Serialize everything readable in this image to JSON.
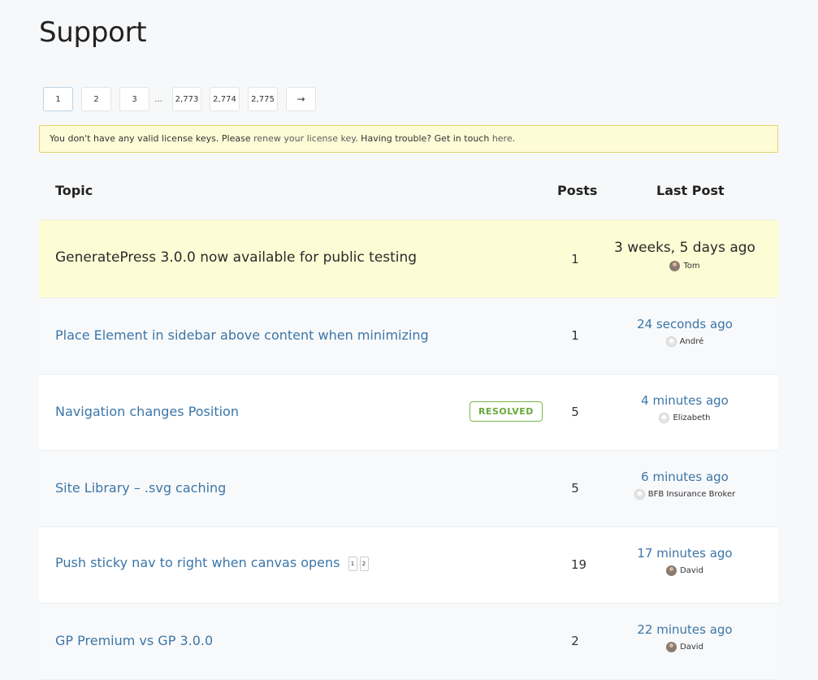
{
  "page": {
    "title": "Support"
  },
  "pagination": {
    "pages": [
      "1",
      "2",
      "3",
      "2,773",
      "2,774",
      "2,775"
    ],
    "dots": "…",
    "next_arrow": "→"
  },
  "notice": {
    "text_before": "You don't have any valid license keys. Please ",
    "renew_link": "renew your license key",
    "text_middle": ". Having trouble? Get in touch ",
    "here_link": "here",
    "text_after": "."
  },
  "table": {
    "headers": {
      "topic": "Topic",
      "posts": "Posts",
      "last_post": "Last Post"
    },
    "rows": [
      {
        "title": "GeneratePress 3.0.0 now available for public testing",
        "posts": "1",
        "last_time": "3 weeks, 5 days ago",
        "author": "Tom",
        "avatar": "photo"
      },
      {
        "title": "Place Element in sidebar above content when minimizing",
        "posts": "1",
        "last_time": "24 seconds ago",
        "author": "André",
        "avatar": "generic"
      },
      {
        "title": "Navigation changes Position",
        "badge": "RESOLVED",
        "posts": "5",
        "last_time": "4 minutes ago",
        "author": "Elizabeth",
        "avatar": "generic"
      },
      {
        "title": "Site Library – .svg caching",
        "posts": "5",
        "last_time": "6 minutes ago",
        "author": "BFB Insurance Broker",
        "avatar": "generic"
      },
      {
        "title": "Push sticky nav to right when canvas opens",
        "subpages": [
          "1",
          "2"
        ],
        "posts": "19",
        "last_time": "17 minutes ago",
        "author": "David",
        "avatar": "photo"
      },
      {
        "title": "GP Premium vs GP 3.0.0",
        "posts": "2",
        "last_time": "22 minutes ago",
        "author": "David",
        "avatar": "photo"
      }
    ]
  }
}
